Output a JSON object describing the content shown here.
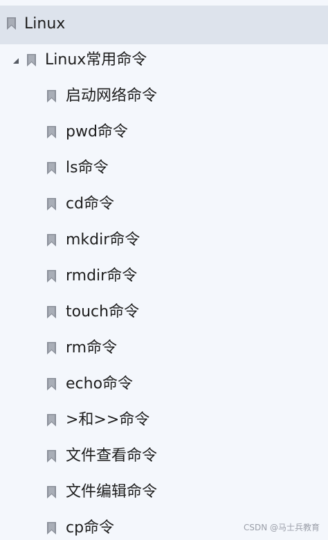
{
  "tree": {
    "root": {
      "label": "Linux"
    },
    "group": {
      "label": "Linux常用命令",
      "expanded": true
    },
    "items": [
      {
        "label": "启动网络命令"
      },
      {
        "label": "pwd命令"
      },
      {
        "label": "ls命令"
      },
      {
        "label": "cd命令"
      },
      {
        "label": "mkdir命令"
      },
      {
        "label": "rmdir命令"
      },
      {
        "label": "touch命令"
      },
      {
        "label": "rm命令"
      },
      {
        "label": "echo命令"
      },
      {
        "label": ">和>>命令"
      },
      {
        "label": "文件查看命令"
      },
      {
        "label": "文件编辑命令"
      },
      {
        "label": "cp命令"
      }
    ]
  },
  "watermark": {
    "text": "CSDN @马士兵教育"
  },
  "colors": {
    "selected_row": "#dde3ec",
    "panel_bg": "#f4f7fc",
    "bookmark_icon": "#8a8f99",
    "text": "#1c1c1c"
  },
  "icons": {
    "bookmark": "bookmark-icon",
    "expand": "triangle-expanded-icon"
  }
}
